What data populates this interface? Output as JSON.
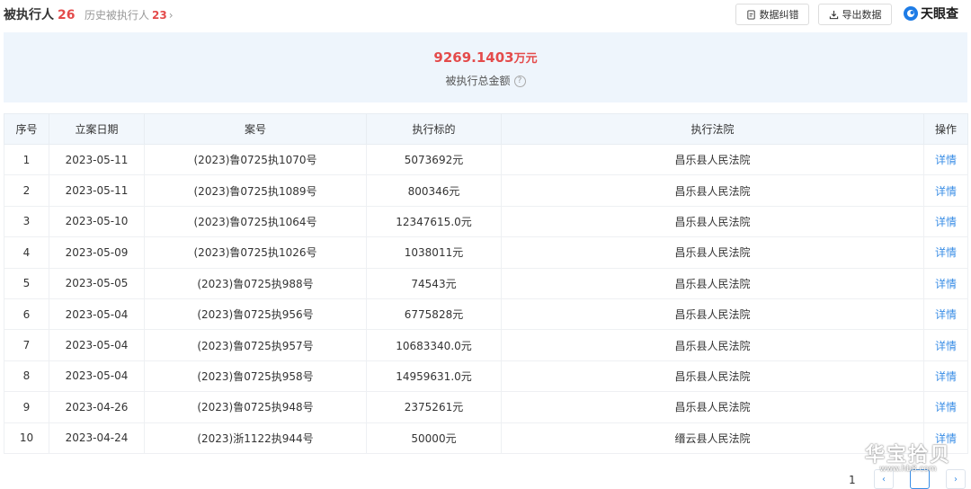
{
  "header": {
    "active_tab_label": "被执行人",
    "active_tab_count": "26",
    "history_tab_label": "历史被执行人",
    "history_tab_count": "23",
    "correct_button": "数据纠错",
    "export_button": "导出数据",
    "brand_name": "天眼查"
  },
  "summary": {
    "amount": "9269.1403",
    "unit": "万元",
    "label": "被执行总金额"
  },
  "table": {
    "columns": [
      "序号",
      "立案日期",
      "案号",
      "执行标的",
      "执行法院",
      "操作"
    ],
    "rows": [
      [
        "1",
        "2023-05-11",
        "(2023)鲁0725执1070号",
        "5073692元",
        "昌乐县人民法院",
        "详情"
      ],
      [
        "2",
        "2023-05-11",
        "(2023)鲁0725执1089号",
        "800346元",
        "昌乐县人民法院",
        "详情"
      ],
      [
        "3",
        "2023-05-10",
        "(2023)鲁0725执1064号",
        "12347615.0元",
        "昌乐县人民法院",
        "详情"
      ],
      [
        "4",
        "2023-05-09",
        "(2023)鲁0725执1026号",
        "1038011元",
        "昌乐县人民法院",
        "详情"
      ],
      [
        "5",
        "2023-05-05",
        "(2023)鲁0725执988号",
        "74543元",
        "昌乐县人民法院",
        "详情"
      ],
      [
        "6",
        "2023-05-04",
        "(2023)鲁0725执956号",
        "6775828元",
        "昌乐县人民法院",
        "详情"
      ],
      [
        "7",
        "2023-05-04",
        "(2023)鲁0725执957号",
        "10683340.0元",
        "昌乐县人民法院",
        "详情"
      ],
      [
        "8",
        "2023-05-04",
        "(2023)鲁0725执958号",
        "14959631.0元",
        "昌乐县人民法院",
        "详情"
      ],
      [
        "9",
        "2023-04-26",
        "(2023)鲁0725执948号",
        "2375261元",
        "昌乐县人民法院",
        "详情"
      ],
      [
        "10",
        "2023-04-24",
        "(2023)浙1122执944号",
        "50000元",
        "缙云县人民法院",
        "详情"
      ]
    ]
  },
  "pagination": {
    "current_page": "1"
  },
  "watermark": {
    "title": "华宝拾贝",
    "url": "www.hb8.com"
  },
  "colors": {
    "accent_red": "#e44b4b",
    "link_blue": "#3a8ee6",
    "summary_bg": "#eef5fc"
  }
}
